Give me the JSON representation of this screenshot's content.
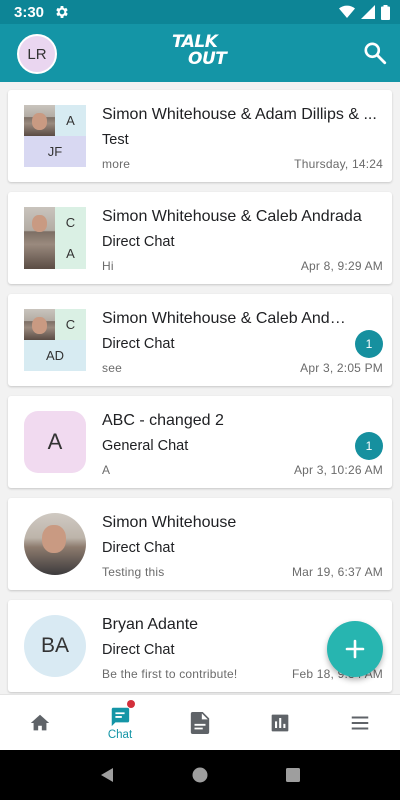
{
  "status_bar": {
    "time": "3:30"
  },
  "header": {
    "avatar_initials": "LR",
    "logo_line1": "TALK",
    "logo_line2": "OUT"
  },
  "conversations": [
    {
      "name": "Simon Whitehouse & Adam Dillips & ...",
      "type": "Test",
      "preview": "more",
      "time": "Thursday, 14:24",
      "tiles": [
        "A",
        "JF"
      ]
    },
    {
      "name": "Simon Whitehouse & Caleb Andrada",
      "type": "Direct Chat",
      "preview": "Hi",
      "time": "Apr 8, 9:29 AM",
      "tiles": [
        "C",
        "A"
      ]
    },
    {
      "name": "Simon Whitehouse & Caleb Andrada...",
      "type": "Direct Chat",
      "preview": "see",
      "time": "Apr 3, 2:05 PM",
      "tiles": [
        "C",
        "AD"
      ],
      "unread": "1"
    },
    {
      "name": "ABC - changed 2",
      "type": "General Chat",
      "preview": "A",
      "time": "Apr 3, 10:26 AM",
      "tiles": [
        "A"
      ],
      "unread": "1"
    },
    {
      "name": "Simon Whitehouse",
      "type": "Direct Chat",
      "preview": "Testing this",
      "time": "Mar 19, 6:37 AM"
    },
    {
      "name": "Bryan Adante",
      "type": "Direct Chat",
      "preview": "Be the first to contribute!",
      "time": "Feb 18, 9:34 AM",
      "tiles": [
        "BA"
      ]
    }
  ],
  "bottom_nav": {
    "chat_label": "Chat"
  },
  "colors": {
    "primary": "#1495a6",
    "status_bar": "#0d8596",
    "fab": "#27b5b0",
    "badge": "#16909f",
    "notification_dot": "#d32f3b"
  }
}
